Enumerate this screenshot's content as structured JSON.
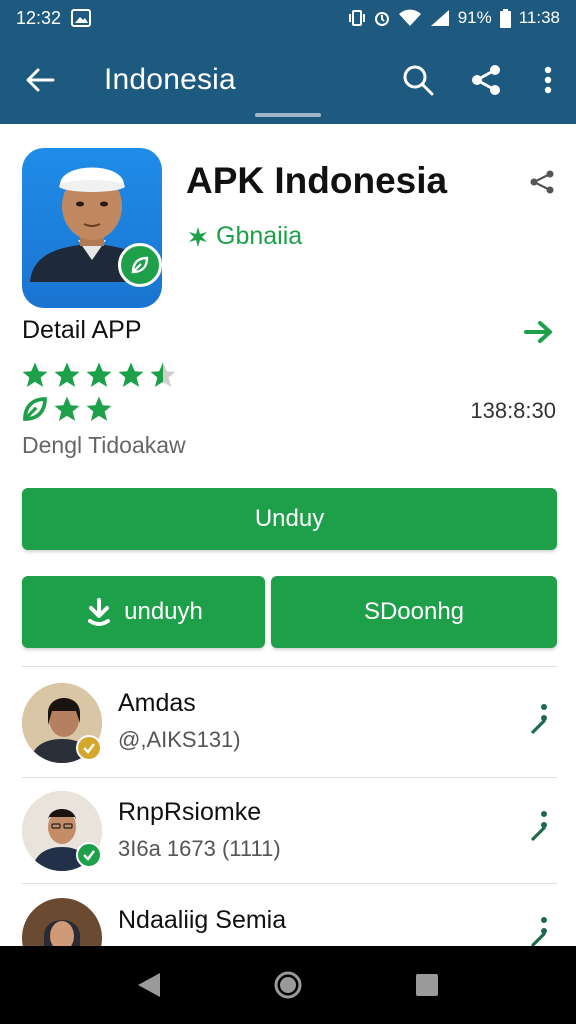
{
  "status_bar": {
    "time": "12:32",
    "battery_text": "91%",
    "right_time": "11:38"
  },
  "app_bar": {
    "title": "Indonesia",
    "icons": [
      "back-arrow-icon",
      "search-icon",
      "share-icon",
      "more-vert-icon"
    ]
  },
  "app": {
    "name": "APK Indonesia",
    "developer": "Gbnaiia",
    "developer_icon": "leaf-icon"
  },
  "detail": {
    "title": "Detail APP",
    "rating": 4.5,
    "rating_secondary": 3,
    "time": "138:8:30",
    "status": "Dengl Tidoakaw"
  },
  "buttons": {
    "main": "Unduy",
    "left": "unduyh",
    "right": "SDoonhg"
  },
  "list": [
    {
      "name": "Amdas",
      "sub": "@,AIKS131)",
      "badge_color": "#d4a72c"
    },
    {
      "name": "RnpRsiomke",
      "sub": "3I6a 1673 (1111)",
      "badge_color": "#1ea04a"
    },
    {
      "name": "Ndaaliig Semia",
      "sub": "",
      "badge_color": "#1ea04a"
    }
  ],
  "colors": {
    "primary_bar": "#1e5a80",
    "accent_green": "#1ea04a"
  },
  "nav_bar": {
    "icons": [
      "back-triangle-icon",
      "home-circle-icon",
      "recents-square-icon"
    ]
  }
}
